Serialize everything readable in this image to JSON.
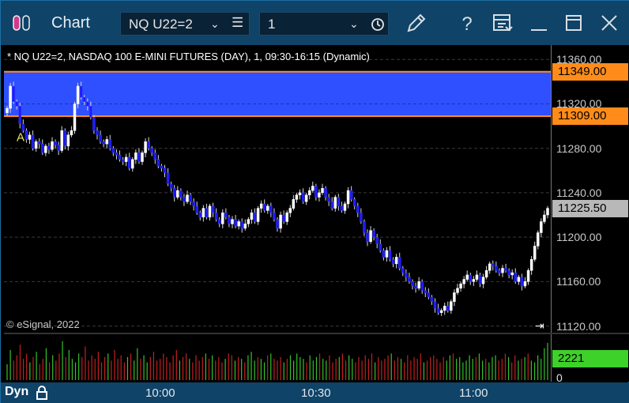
{
  "window": {
    "title": "Chart",
    "symbol": "NQ U22=2",
    "interval": "1",
    "icons": [
      "pencil-icon",
      "help-icon",
      "layout-icon",
      "minimize-icon",
      "maximize-icon",
      "close-icon"
    ]
  },
  "chart_data": {
    "type": "candlestick",
    "title": "* NQ U22=2, NASDAQ 100 E-MINI FUTURES (DAY), 1, 09:30-16:15 (Dynamic)",
    "copyright": "© eSignal, 2022",
    "y_ticks": [
      "11360.00",
      "11320.00",
      "11280.00",
      "11240.00",
      "11200.00",
      "11160.00",
      "11120.00"
    ],
    "ylim": [
      11114,
      11373
    ],
    "x_ticks": [
      "10:00",
      "10:30",
      "11:00"
    ],
    "zone": {
      "upper": 11349,
      "lower": 11309,
      "upper_label": "11349.00",
      "lower_label": "11309.00",
      "color": "#2f50ff"
    },
    "last_price": "11225.50",
    "marker_label": "A",
    "volume_last": "2221",
    "volume_zero": "0",
    "close_path": [
      11316,
      11336,
      11322,
      11318,
      11302,
      11296,
      11288,
      11292,
      11280,
      11286,
      11284,
      11276,
      11282,
      11279,
      11286,
      11283,
      11278,
      11296,
      11282,
      11292,
      11296,
      11320,
      11336,
      11326,
      11322,
      11318,
      11308,
      11296,
      11292,
      11286,
      11284,
      11288,
      11280,
      11276,
      11274,
      11270,
      11268,
      11272,
      11262,
      11270,
      11276,
      11268,
      11276,
      11286,
      11280,
      11276,
      11270,
      11264,
      11262,
      11258,
      11248,
      11244,
      11236,
      11242,
      11236,
      11232,
      11238,
      11232,
      11228,
      11222,
      11218,
      11226,
      11218,
      11228,
      11222,
      11216,
      11212,
      11222,
      11218,
      11212,
      11216,
      11210,
      11214,
      11208,
      11212,
      11216,
      11222,
      11214,
      11226,
      11230,
      11224,
      11228,
      11222,
      11216,
      11208,
      11220,
      11214,
      11222,
      11226,
      11234,
      11238,
      11240,
      11232,
      11238,
      11242,
      11246,
      11236,
      11240,
      11244,
      11236,
      11232,
      11226,
      11236,
      11228,
      11224,
      11230,
      11242,
      11234,
      11228,
      11222,
      11214,
      11204,
      11196,
      11206,
      11200,
      11194,
      11188,
      11182,
      11188,
      11180,
      11176,
      11182,
      11172,
      11168,
      11164,
      11160,
      11156,
      11154,
      11160,
      11152,
      11150,
      11146,
      11142,
      11136,
      11132,
      11134,
      11138,
      11134,
      11142,
      11150,
      11154,
      11158,
      11162,
      11166,
      11160,
      11162,
      11166,
      11158,
      11164,
      11170,
      11176,
      11174,
      11170,
      11168,
      11172,
      11170,
      11166,
      11168,
      11160,
      11164,
      11156,
      11160,
      11170,
      11180,
      11192,
      11204,
      11214,
      11220,
      11226
    ],
    "volume_profile": [
      18,
      34,
      22,
      28,
      40,
      24,
      30,
      20,
      26,
      32,
      18,
      24,
      36,
      20,
      28,
      22,
      30,
      44,
      26,
      34,
      24,
      20,
      30,
      26,
      38,
      22,
      28,
      24,
      32,
      20,
      26,
      30,
      22,
      34,
      24,
      28,
      20,
      26,
      30,
      22,
      36,
      24,
      28,
      20,
      26,
      32,
      22,
      24,
      30,
      26,
      20,
      28,
      34,
      22,
      26,
      30,
      24,
      20,
      28,
      22,
      26,
      30,
      24,
      28,
      22,
      26,
      20,
      24,
      30,
      28,
      22,
      26,
      24,
      20,
      28,
      32,
      22,
      26,
      24,
      20,
      28,
      30,
      24,
      22,
      26,
      20,
      24,
      28,
      22,
      30,
      26,
      24,
      20,
      28,
      22,
      26,
      30,
      24,
      22,
      28,
      20,
      24,
      26,
      30,
      22,
      28,
      24,
      20,
      26,
      22,
      28,
      24,
      30,
      20,
      26,
      22,
      24,
      28,
      30,
      22,
      26,
      24,
      20,
      28,
      22,
      26,
      24,
      30,
      20,
      22,
      26,
      28,
      24,
      20,
      26,
      22,
      28,
      30,
      24,
      26,
      20,
      22,
      28,
      24,
      26,
      30,
      22,
      24,
      20,
      26,
      28,
      22,
      24,
      30,
      26,
      20,
      28,
      22,
      24,
      26,
      30,
      22,
      20,
      28,
      24,
      36,
      42
    ]
  },
  "footer": {
    "mode": "Dyn"
  }
}
